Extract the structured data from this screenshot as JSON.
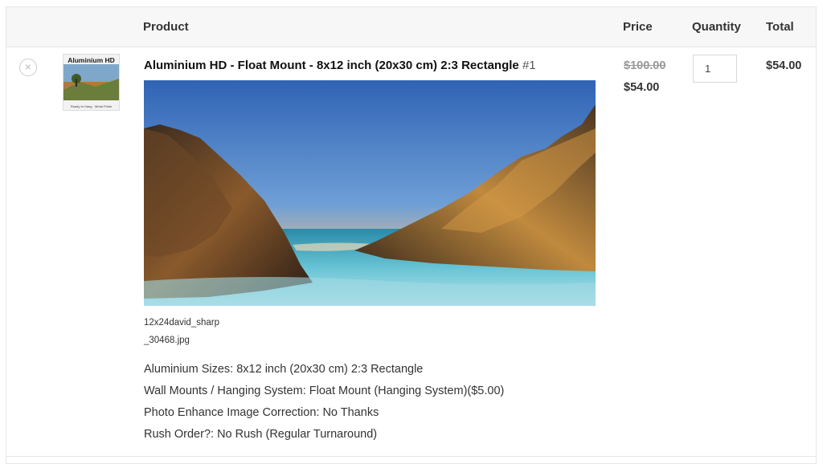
{
  "table_header": {
    "product": "Product",
    "price": "Price",
    "quantity": "Quantity",
    "total": "Total"
  },
  "item": {
    "remove_symbol": "×",
    "thumbnail": {
      "title": "Aluminium HD",
      "footer": "Ready to Hang · Metal Prints"
    },
    "name": "Aluminium HD - Float Mount - 8x12 inch (20x30 cm) 2:3 Rectangle",
    "number": "#1",
    "file_name_line1": "12x24david_sharp",
    "file_name_line2": "_30468.jpg",
    "options": [
      "Aluminium Sizes: 8x12 inch (20x30 cm) 2:3 Rectangle",
      "Wall Mounts / Hanging System: Float Mount (Hanging System)($5.00)",
      "Photo Enhance Image Correction: No Thanks",
      "Rush Order?: No Rush (Regular Turnaround)"
    ],
    "price_original": "$100.00",
    "price_sale": "$54.00",
    "quantity": "1",
    "total": "$54.00"
  },
  "colors": {
    "header_bg": "#f7f7f7",
    "border": "#e6e6e6",
    "strike_price": "#999999"
  }
}
